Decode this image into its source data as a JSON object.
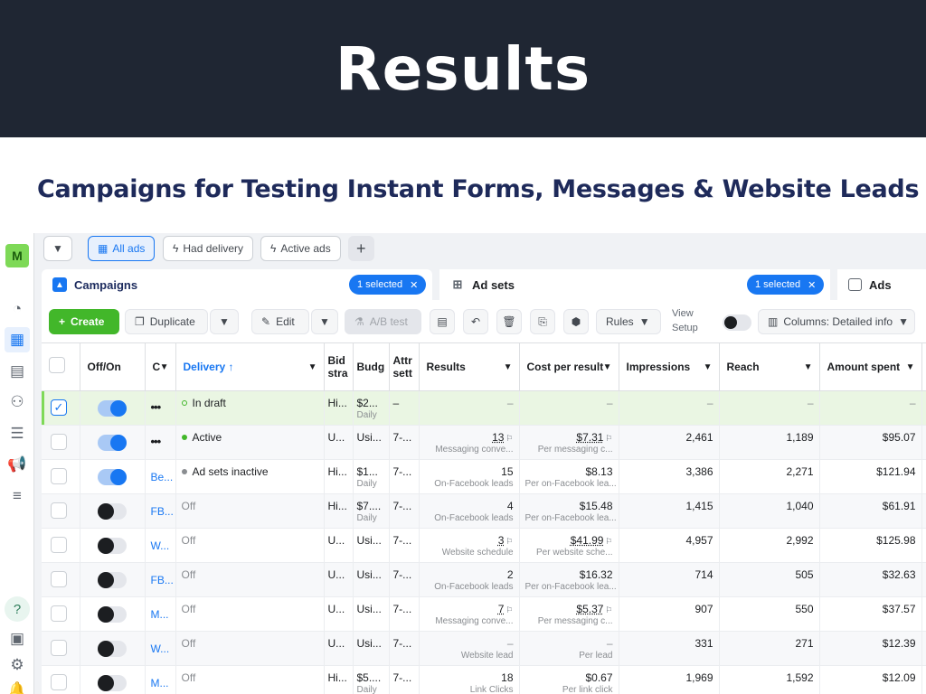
{
  "banner": {
    "title": "Results"
  },
  "subtitle": "Campaigns for Testing Instant Forms, Messages & Website Leads",
  "rail": {
    "avatar": "M",
    "help": "?"
  },
  "filters": {
    "all_ads": "All ads",
    "had_delivery": "Had delivery",
    "active_ads": "Active ads",
    "add": "+"
  },
  "tabs": {
    "campaigns": {
      "label": "Campaigns",
      "pill": "1 selected"
    },
    "ad_sets": {
      "label": "Ad sets",
      "pill": "1 selected"
    },
    "ads": {
      "label": "Ads"
    }
  },
  "toolbar": {
    "create": "Create",
    "duplicate": "Duplicate",
    "edit": "Edit",
    "ab_test": "A/B test",
    "rules": "Rules",
    "view_setup_1": "View",
    "view_setup_2": "Setup",
    "columns": "Columns: Detailed info"
  },
  "columns": {
    "off_on": "Off/On",
    "name": "C",
    "delivery": "Delivery ↑",
    "bid": "Bid stra",
    "budget": "Budg",
    "attr": "Attr sett",
    "results": "Results",
    "cpr": "Cost per result",
    "impressions": "Impressions",
    "reach": "Reach",
    "spent": "Amount spent"
  },
  "rows": [
    {
      "name": "",
      "delivery": "In draft",
      "bid": "Hi...",
      "budget": "$2...",
      "budget_sub": "Daily",
      "attr": "–",
      "results": "–",
      "results_sub": "",
      "cpr": "–",
      "cpr_sub": "",
      "impressions": "–",
      "reach": "–",
      "spent": "–"
    },
    {
      "name": "",
      "delivery": "Active",
      "bid": "U...",
      "budget": "Usi...",
      "budget_sub": "",
      "attr": "7-...",
      "results": "13",
      "results_sub": "Messaging conve...",
      "cpr": "$7.31",
      "cpr_sub": "Per messaging c...",
      "impressions": "2,461",
      "reach": "1,189",
      "spent": "$95.07"
    },
    {
      "name": "Be...",
      "delivery": "Ad sets inactive",
      "bid": "Hi...",
      "budget": "$1...",
      "budget_sub": "Daily",
      "attr": "7-...",
      "results": "15",
      "results_sub": "On-Facebook leads",
      "cpr": "$8.13",
      "cpr_sub": "Per on-Facebook lea...",
      "impressions": "3,386",
      "reach": "2,271",
      "spent": "$121.94"
    },
    {
      "name": "FB...",
      "delivery": "Off",
      "bid": "Hi...",
      "budget": "$7....",
      "budget_sub": "Daily",
      "attr": "7-...",
      "results": "4",
      "results_sub": "On-Facebook leads",
      "cpr": "$15.48",
      "cpr_sub": "Per on-Facebook lea...",
      "impressions": "1,415",
      "reach": "1,040",
      "spent": "$61.91"
    },
    {
      "name": "W...",
      "delivery": "Off",
      "bid": "U...",
      "budget": "Usi...",
      "budget_sub": "",
      "attr": "7-...",
      "results": "3",
      "results_sub": "Website schedule",
      "cpr": "$41.99",
      "cpr_sub": "Per website sche...",
      "impressions": "4,957",
      "reach": "2,992",
      "spent": "$125.98"
    },
    {
      "name": "FB...",
      "delivery": "Off",
      "bid": "U...",
      "budget": "Usi...",
      "budget_sub": "",
      "attr": "7-...",
      "results": "2",
      "results_sub": "On-Facebook leads",
      "cpr": "$16.32",
      "cpr_sub": "Per on-Facebook lea...",
      "impressions": "714",
      "reach": "505",
      "spent": "$32.63"
    },
    {
      "name": "M...",
      "delivery": "Off",
      "bid": "U...",
      "budget": "Usi...",
      "budget_sub": "",
      "attr": "7-...",
      "results": "7",
      "results_sub": "Messaging conve...",
      "cpr": "$5.37",
      "cpr_sub": "Per messaging c...",
      "impressions": "907",
      "reach": "550",
      "spent": "$37.57"
    },
    {
      "name": "W...",
      "delivery": "Off",
      "bid": "U...",
      "budget": "Usi...",
      "budget_sub": "",
      "attr": "7-...",
      "results": "–",
      "results_sub": "Website lead",
      "cpr": "–",
      "cpr_sub": "Per lead",
      "impressions": "331",
      "reach": "271",
      "spent": "$12.39"
    },
    {
      "name": "M...",
      "delivery": "Off",
      "bid": "Hi...",
      "budget": "$5....",
      "budget_sub": "Daily",
      "attr": "7-...",
      "results": "18",
      "results_sub": "Link Clicks",
      "cpr": "$0.67",
      "cpr_sub": "Per link click",
      "impressions": "1,969",
      "reach": "1,592",
      "spent": "$12.09"
    }
  ],
  "colors": {
    "accent": "#1877f2",
    "create": "#42b72a",
    "banner": "#1f2633",
    "subtitle": "#1e2a5a",
    "selected_row": "#eaf6e3"
  }
}
